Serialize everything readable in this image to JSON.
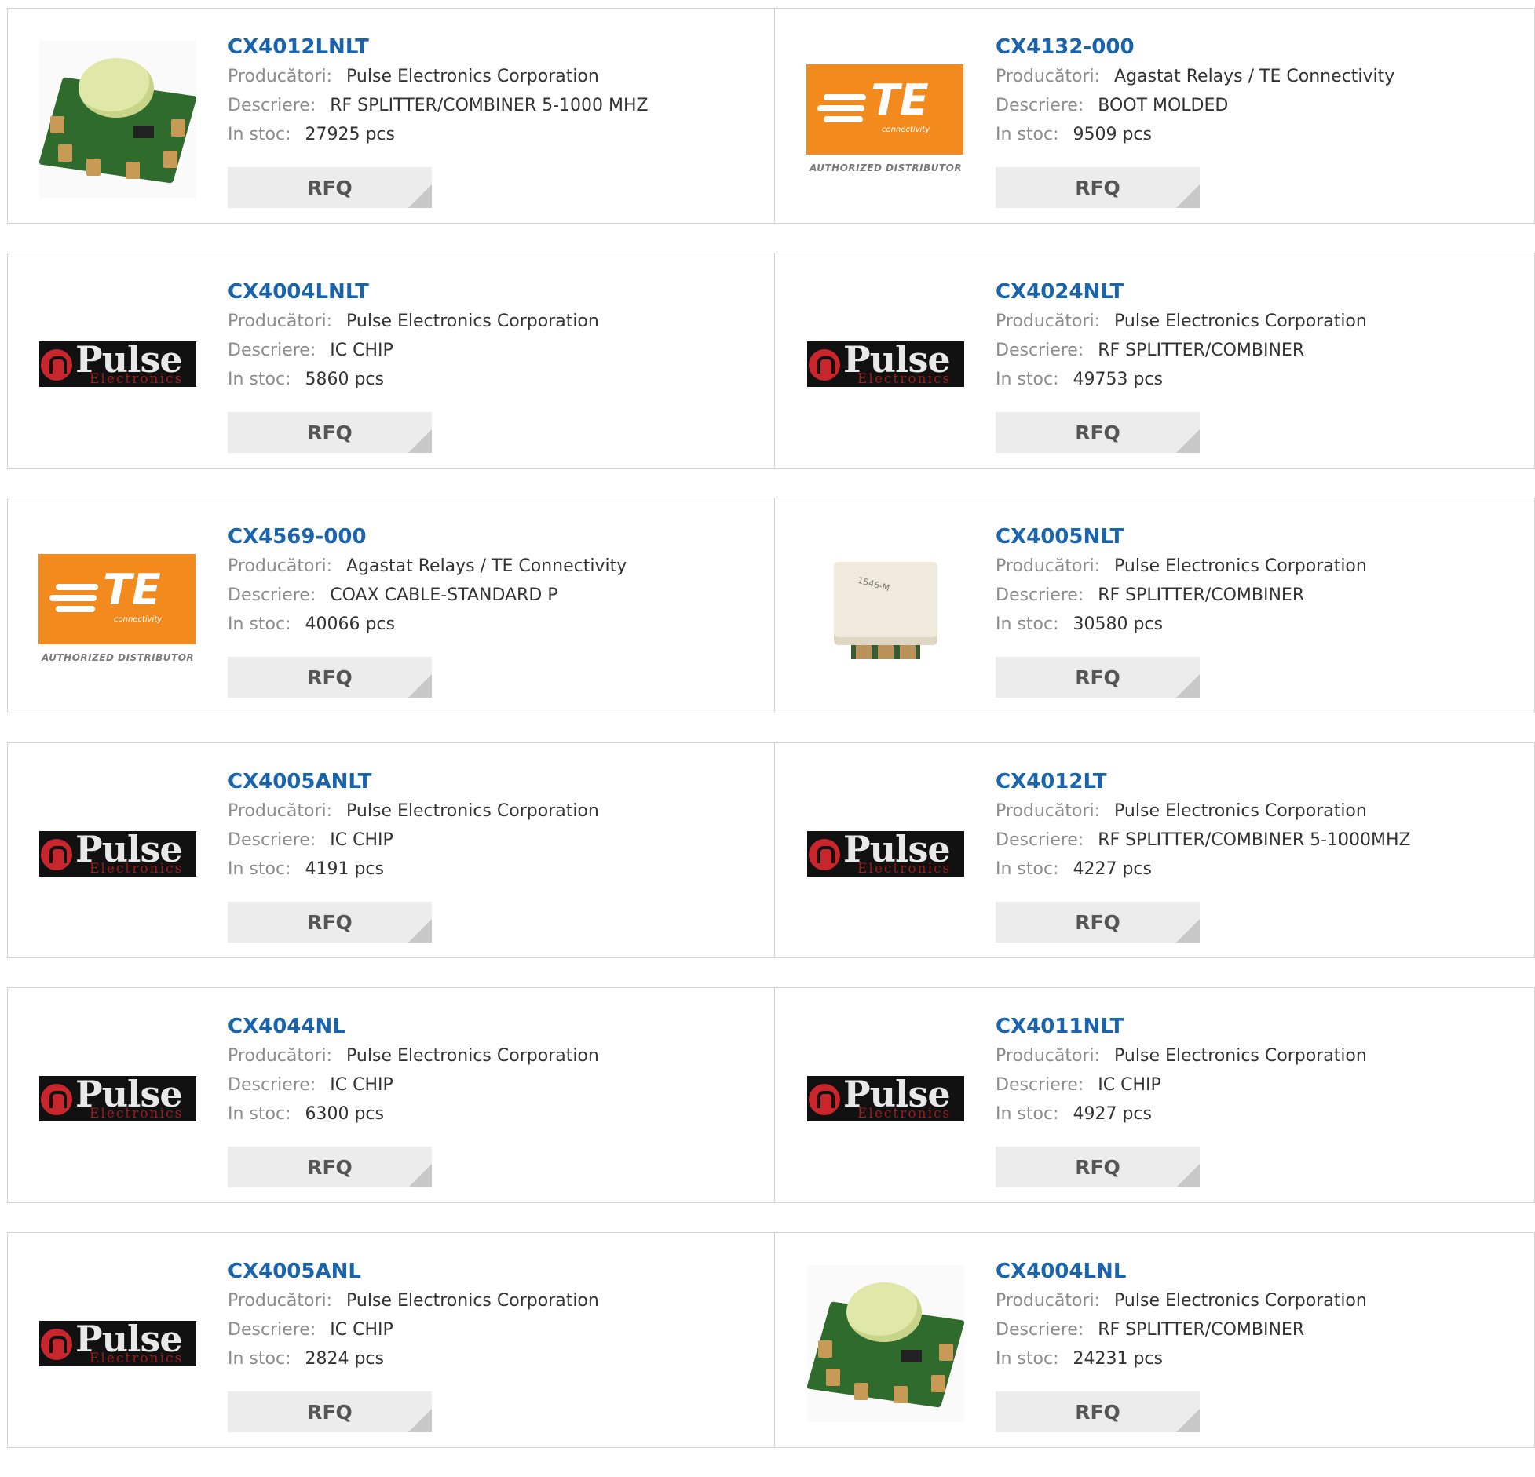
{
  "labels": {
    "manufacturer": "Producători:",
    "description": "Descriere:",
    "stock": "In stoc:",
    "rfq": "RFQ"
  },
  "logos": {
    "pulse_word": "Pulse",
    "pulse_sub": "Electronics",
    "te_word": "TE",
    "te_sub": "connectivity",
    "te_auth": "AUTHORIZED DISTRIBUTOR",
    "chip_marking": "1546-M"
  },
  "colors": {
    "part_link": "#1a63ad",
    "label_gray": "#8c8c8c",
    "rfq_bg": "#ececec",
    "te_orange": "#f28a1e",
    "pulse_red": "#c8262c"
  },
  "products": [
    {
      "part": "CX4012LNLT",
      "manufacturer": "Pulse Electronics Corporation",
      "description": "RF SPLITTER/COMBINER 5-1000 MHZ",
      "stock": "27925 pcs",
      "image": "green-splitter-chip"
    },
    {
      "part": "CX4132-000",
      "manufacturer": "Agastat Relays / TE Connectivity",
      "description": "BOOT MOLDED",
      "stock": "9509 pcs",
      "image": "te-logo"
    },
    {
      "part": "CX4004LNLT",
      "manufacturer": "Pulse Electronics Corporation",
      "description": "IC CHIP",
      "stock": "5860 pcs",
      "image": "pulse-logo"
    },
    {
      "part": "CX4024NLT",
      "manufacturer": "Pulse Electronics Corporation",
      "description": "RF SPLITTER/COMBINER",
      "stock": "49753 pcs",
      "image": "pulse-logo"
    },
    {
      "part": "CX4569-000",
      "manufacturer": "Agastat Relays / TE Connectivity",
      "description": "COAX CABLE-STANDARD P",
      "stock": "40066 pcs",
      "image": "te-logo"
    },
    {
      "part": "CX4005NLT",
      "manufacturer": "Pulse Electronics Corporation",
      "description": "RF SPLITTER/COMBINER",
      "stock": "30580 pcs",
      "image": "white-transformer-chip"
    },
    {
      "part": "CX4005ANLT",
      "manufacturer": "Pulse Electronics Corporation",
      "description": "IC CHIP",
      "stock": "4191 pcs",
      "image": "pulse-logo"
    },
    {
      "part": "CX4012LT",
      "manufacturer": "Pulse Electronics Corporation",
      "description": "RF SPLITTER/COMBINER 5-1000MHZ",
      "stock": "4227 pcs",
      "image": "pulse-logo"
    },
    {
      "part": "CX4044NL",
      "manufacturer": "Pulse Electronics Corporation",
      "description": "IC CHIP",
      "stock": "6300 pcs",
      "image": "pulse-logo"
    },
    {
      "part": "CX4011NLT",
      "manufacturer": "Pulse Electronics Corporation",
      "description": "IC CHIP",
      "stock": "4927 pcs",
      "image": "pulse-logo"
    },
    {
      "part": "CX4005ANL",
      "manufacturer": "Pulse Electronics Corporation",
      "description": "IC CHIP",
      "stock": "2824 pcs",
      "image": "pulse-logo"
    },
    {
      "part": "CX4004LNL",
      "manufacturer": "Pulse Electronics Corporation",
      "description": "RF SPLITTER/COMBINER",
      "stock": "24231 pcs",
      "image": "green-splitter-chip"
    }
  ]
}
